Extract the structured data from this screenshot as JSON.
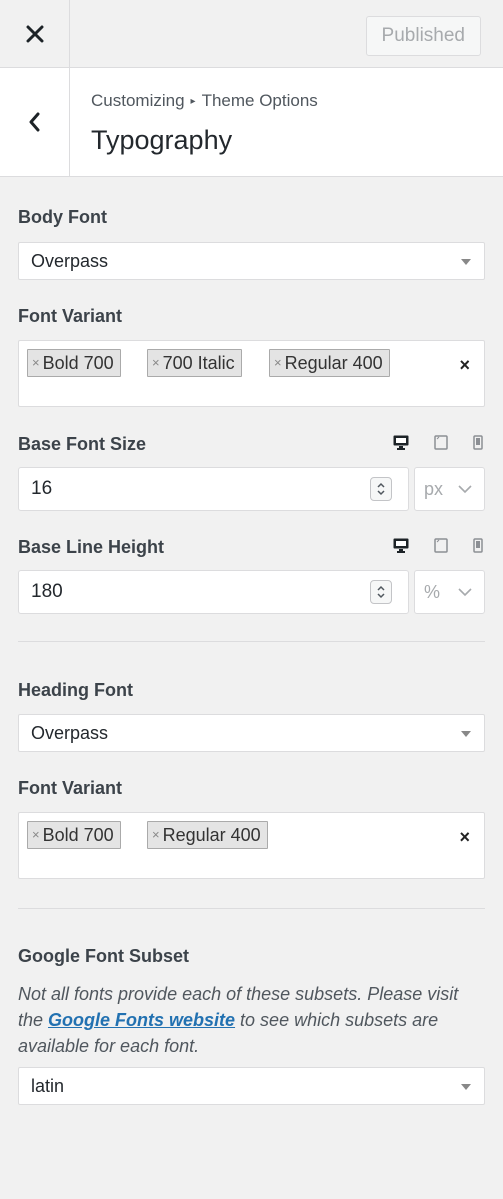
{
  "header": {
    "published_label": "Published"
  },
  "section": {
    "breadcrumb_parent": "Customizing",
    "breadcrumb_separator": "▸",
    "breadcrumb_child": "Theme Options",
    "title": "Typography"
  },
  "body_font": {
    "label": "Body Font",
    "value": "Overpass"
  },
  "body_variant": {
    "label": "Font Variant",
    "tags": [
      "Bold 700",
      "700 Italic",
      "Regular 400"
    ],
    "clear": "×"
  },
  "base_font_size": {
    "label": "Base Font Size",
    "value": "16",
    "unit": "px"
  },
  "base_line_height": {
    "label": "Base Line Height",
    "value": "180",
    "unit": "%"
  },
  "heading_font": {
    "label": "Heading Font",
    "value": "Overpass"
  },
  "heading_variant": {
    "label": "Font Variant",
    "tags": [
      "Bold 700",
      "Regular 400"
    ],
    "clear": "×"
  },
  "subset": {
    "label": "Google Font Subset",
    "desc_before": "Not all fonts provide each of these subsets. Please visit the ",
    "desc_link": "Google Fonts website",
    "desc_after": " to see which subsets are available for each font.",
    "value": "latin"
  },
  "tag_remove_glyph": "×",
  "colors": {
    "link": "#2271b1",
    "border": "#dcdcde",
    "panel_bg": "#f1f1f1"
  }
}
